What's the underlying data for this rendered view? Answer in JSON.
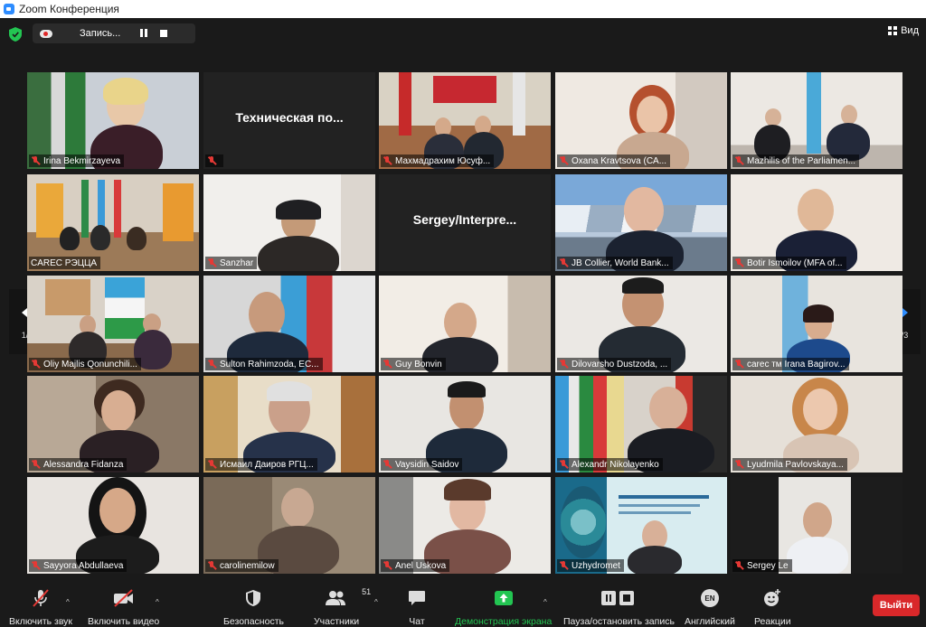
{
  "window": {
    "title": "Zoom Конференция"
  },
  "topbar": {
    "recording_label": "Запись...",
    "view_label": "Вид"
  },
  "colors": {
    "accent": "#2d8cff",
    "active_speaker": "#e6e14b",
    "muted": "#e53935",
    "leave": "#d9282a",
    "share": "#23c552"
  },
  "pages": {
    "left": "1/3",
    "right": "1/3"
  },
  "tiles": [
    {
      "name": "Irina Bekmirzayeva"
    },
    {
      "name": "",
      "display_text": "Техническая по..."
    },
    {
      "name": "Махмадрахим Юсуф..."
    },
    {
      "name": "Oxana Kravtsova (CA..."
    },
    {
      "name": "Mazhilis of the Parliamen..."
    },
    {
      "name": "CAREC РЭЦЦА"
    },
    {
      "name": "Sanzhar"
    },
    {
      "name": "",
      "display_text": "Sergey/Interpre..."
    },
    {
      "name": "JB Collier, World Bank..."
    },
    {
      "name": "Botir Ismoilov (MFA of..."
    },
    {
      "name": "Oliy Majlis Qonunchili..."
    },
    {
      "name": "Sulton Rahimzoda, EC..."
    },
    {
      "name": "Guy Bonvin"
    },
    {
      "name": "Dilovarsho Dustzoda, ..."
    },
    {
      "name": "carec тм Irana Bagirov..."
    },
    {
      "name": "Alessandra Fidanza"
    },
    {
      "name": "Исмаил Даиров РГЦ..."
    },
    {
      "name": "Vaysidin Saidov"
    },
    {
      "name": "Alexandr Nikolayenko"
    },
    {
      "name": "Lyudmila Pavlovskaya..."
    },
    {
      "name": "Sayyora Abdullaeva"
    },
    {
      "name": "carolinemilow"
    },
    {
      "name": "Anel Uskova"
    },
    {
      "name": "Uzhydromet"
    },
    {
      "name": "Sergey Le"
    }
  ],
  "toolbar": {
    "audio": "Включить звук",
    "video": "Включить видео",
    "security": "Безопасность",
    "participants": "Участники",
    "participants_count": "51",
    "chat": "Чат",
    "share": "Демонстрация экрана",
    "pause_record": "Пауза/остановить запись",
    "language": "Английский",
    "language_code": "EN",
    "reactions": "Реакции",
    "leave": "Выйти"
  }
}
